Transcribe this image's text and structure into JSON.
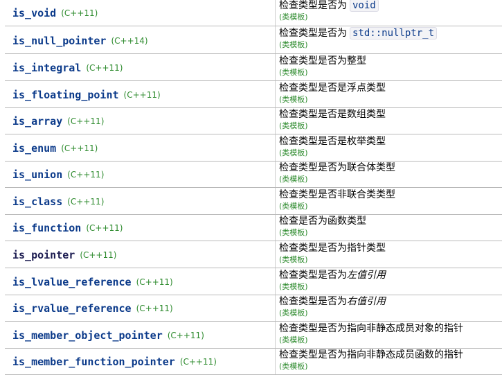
{
  "rows": [
    {
      "name": "is_void",
      "version": "(C++11)",
      "desc_prefix": "检查类型是否为",
      "desc_code": "void",
      "desc_suffix": "",
      "template": "(类模板)"
    },
    {
      "name": "is_null_pointer",
      "version": "(C++14)",
      "desc_prefix": "检查类型是否为",
      "desc_code": "std::nullptr_t",
      "desc_suffix": "",
      "template": "(类模板)"
    },
    {
      "name": "is_integral",
      "version": "(C++11)",
      "desc_prefix": "检查类型是否为整型",
      "desc_code": "",
      "desc_suffix": "",
      "template": "(类模板)"
    },
    {
      "name": "is_floating_point",
      "version": "(C++11)",
      "desc_prefix": "检查类型是否是浮点类型",
      "desc_code": "",
      "desc_suffix": "",
      "template": "(类模板)"
    },
    {
      "name": "is_array",
      "version": "(C++11)",
      "desc_prefix": "检查类型是否是数组类型",
      "desc_code": "",
      "desc_suffix": "",
      "template": "(类模板)"
    },
    {
      "name": "is_enum",
      "version": "(C++11)",
      "desc_prefix": "检查类型是否是枚举类型",
      "desc_code": "",
      "desc_suffix": "",
      "template": "(类模板)"
    },
    {
      "name": "is_union",
      "version": "(C++11)",
      "desc_prefix": "检查类型是否为联合体类型",
      "desc_code": "",
      "desc_suffix": "",
      "template": "(类模板)"
    },
    {
      "name": "is_class",
      "version": "(C++11)",
      "desc_prefix": "检查类型是否非联合类类型",
      "desc_code": "",
      "desc_suffix": "",
      "template": "(类模板)"
    },
    {
      "name": "is_function",
      "version": "(C++11)",
      "desc_prefix": "检查是否为函数类型",
      "desc_code": "",
      "desc_suffix": "",
      "template": "(类模板)"
    },
    {
      "name": "is_pointer",
      "version": "(C++11)",
      "desc_prefix": "检查类型是否为指针类型",
      "desc_code": "",
      "desc_suffix": "",
      "template": "(类模板)"
    },
    {
      "name": "is_lvalue_reference",
      "version": "(C++11)",
      "desc_prefix": "检查类型是否为",
      "desc_code": "",
      "desc_italic": "左值引用",
      "desc_suffix": "",
      "template": "(类模板)"
    },
    {
      "name": "is_rvalue_reference",
      "version": "(C++11)",
      "desc_prefix": "检查类型是否为",
      "desc_code": "",
      "desc_italic": "右值引用",
      "desc_suffix": "",
      "template": "(类模板)"
    },
    {
      "name": "is_member_object_pointer",
      "version": "(C++11)",
      "desc_prefix": "检查类型是否为指向非静态成员对象的指针",
      "desc_code": "",
      "desc_suffix": "",
      "template": "(类模板)"
    },
    {
      "name": "is_member_function_pointer",
      "version": "(C++11)",
      "desc_prefix": "检查类型是否为指向非静态成员函数的指针",
      "desc_code": "",
      "desc_suffix": "",
      "template": "(类模板)"
    }
  ]
}
